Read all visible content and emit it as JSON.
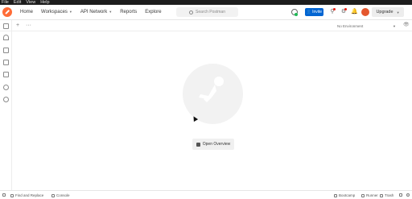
{
  "menubar": [
    "File",
    "Edit",
    "View",
    "Help"
  ],
  "header": {
    "nav": [
      "Home",
      "Workspaces",
      "API Network",
      "Reports",
      "Explore"
    ],
    "search_placeholder": "Search Postman",
    "invite_label": "Invite",
    "upgrade_label": "Upgrade"
  },
  "tabbar": {
    "environment": "No Environment"
  },
  "main": {
    "open_overview": "Open Overview"
  },
  "statusbar": {
    "find_replace": "Find and Replace",
    "console": "Console",
    "bootcamp": "Bootcamp",
    "runner": "Runner",
    "trash": "Trash"
  },
  "colors": {
    "brand": "#ff6c37",
    "invite": "#0265d2"
  }
}
